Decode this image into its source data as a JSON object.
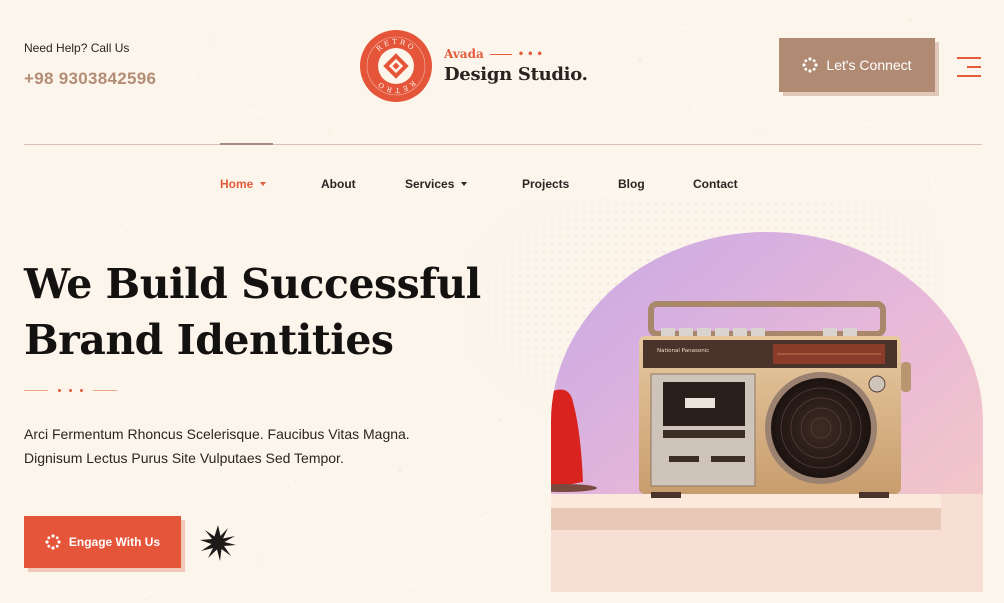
{
  "header": {
    "help_label": "Need Help? Call Us",
    "phone": "+98 9303842596",
    "logo": {
      "badge_text_top": "RETRO",
      "badge_text_bottom": "RETRO",
      "brand_small": "Avada",
      "brand_main": "Design Studio."
    },
    "cta_label": "Let's Connect",
    "menu_icon": "hamburger-icon"
  },
  "nav": {
    "items": [
      {
        "label": "Home",
        "has_dropdown": true,
        "active": true
      },
      {
        "label": "About",
        "has_dropdown": false
      },
      {
        "label": "Services",
        "has_dropdown": true
      },
      {
        "label": "Projects",
        "has_dropdown": false
      },
      {
        "label": "Blog",
        "has_dropdown": false
      },
      {
        "label": "Contact",
        "has_dropdown": false
      }
    ]
  },
  "hero": {
    "title_line1": "We Build Successful",
    "title_line2": "Brand Identities",
    "desc_line1": "Arci Fermentum Rhoncus Scelerisque. Faucibus Vitas Magna.",
    "desc_line2": "Dignisum Lectus Purus Site Vulputaes Sed Tempor.",
    "cta_label": "Engage With Us",
    "image_subject": "vintage-cassette-radio",
    "radio_brand_text": "National Panasonic"
  },
  "colors": {
    "background": "#fcf5ec",
    "accent": "#e45c3c",
    "brown": "#b08a72",
    "text": "#1d1b1a"
  }
}
